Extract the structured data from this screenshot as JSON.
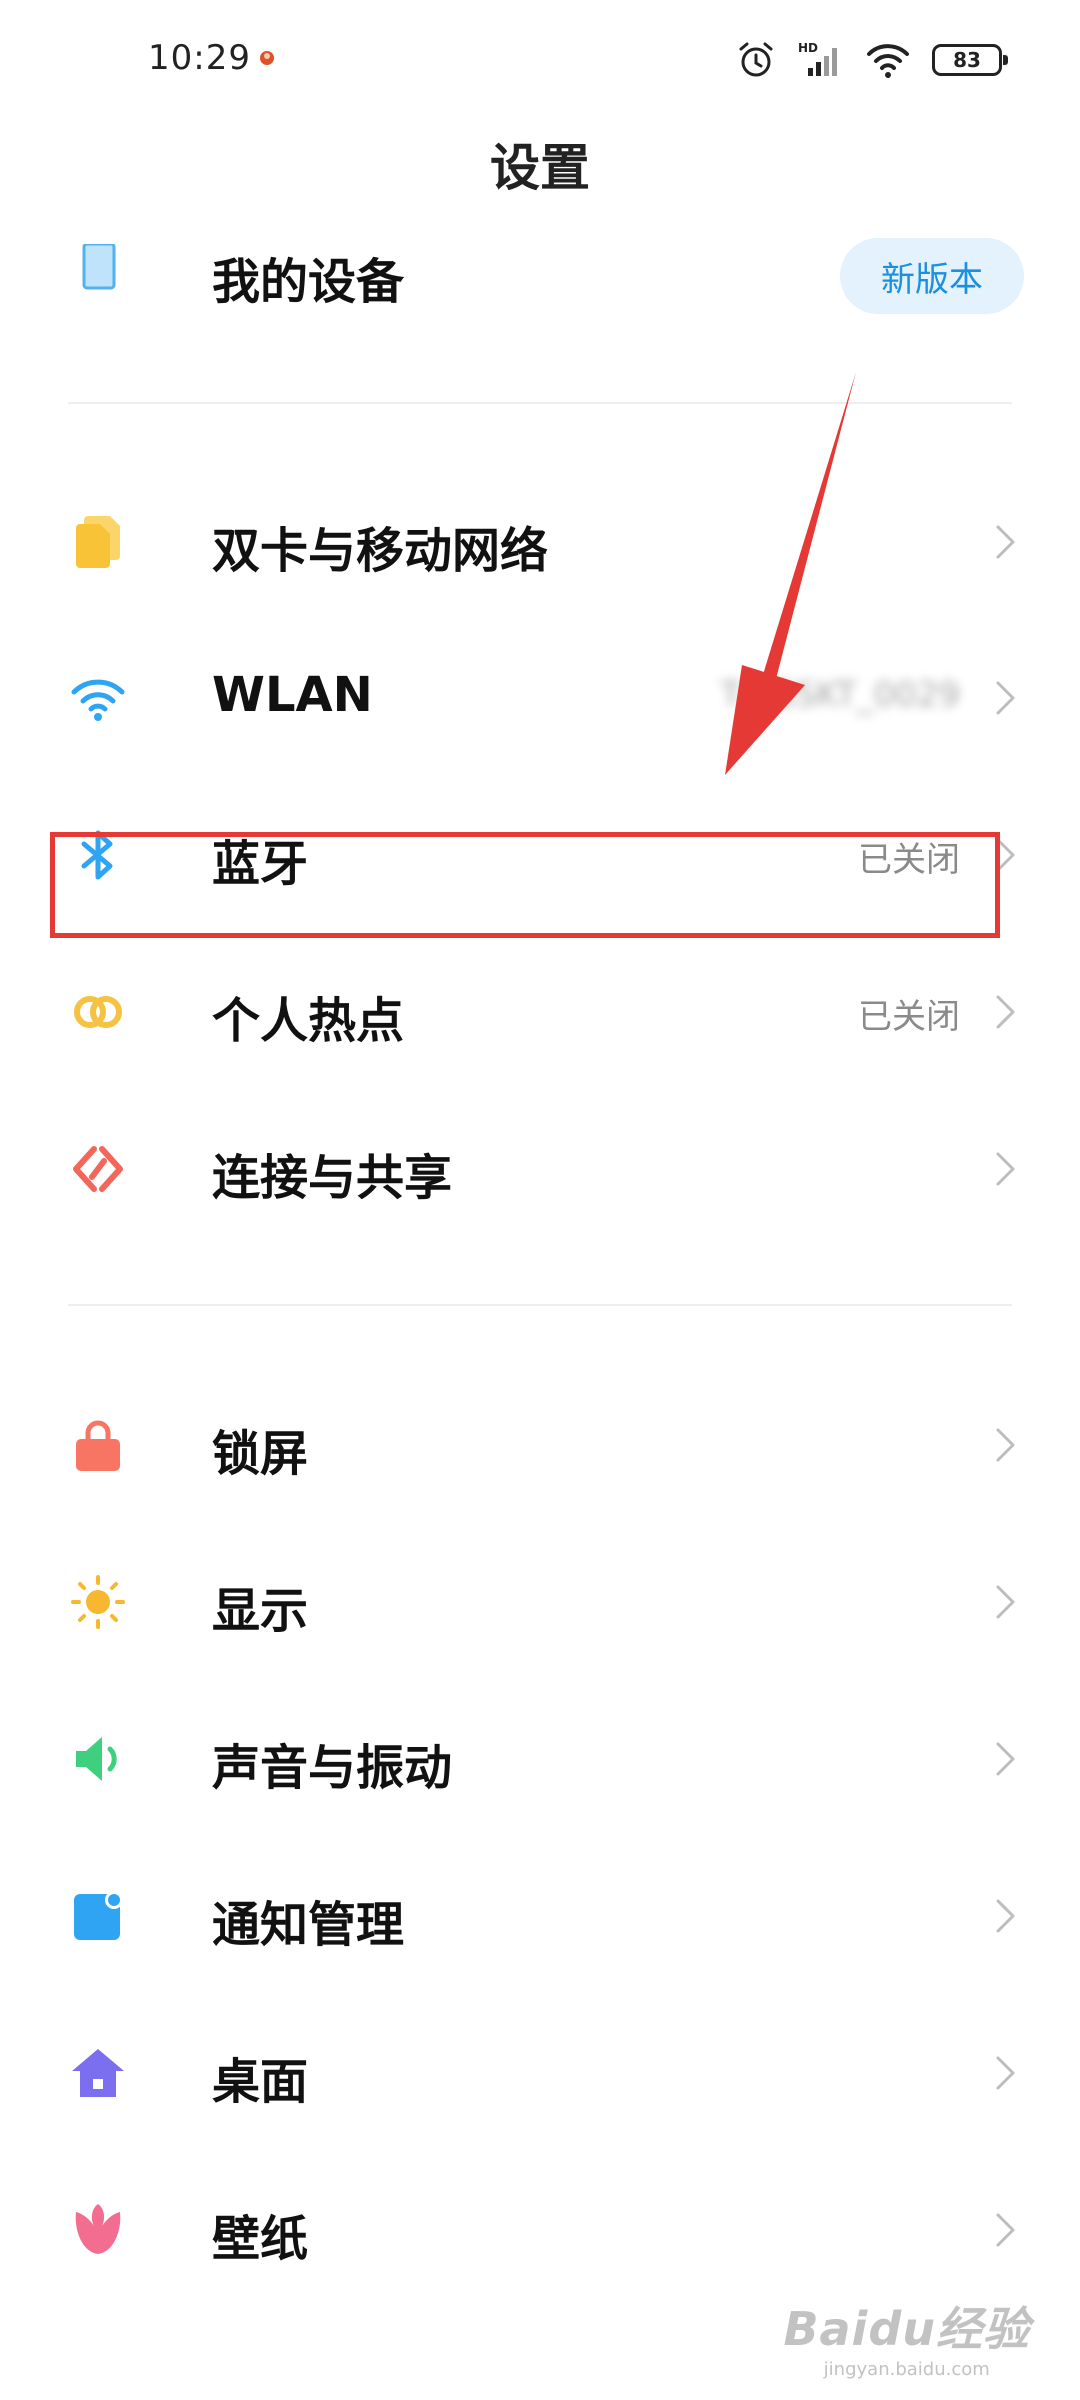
{
  "status_bar": {
    "time": "10:29",
    "battery": "83",
    "icons": [
      "notification-icon",
      "alarm-icon",
      "hd-signal-icon",
      "wifi-icon",
      "battery-icon"
    ]
  },
  "header": {
    "title": "设置"
  },
  "device": {
    "label": "我的设备",
    "badge": "新版本",
    "icon": "phone-icon"
  },
  "network_group": [
    {
      "id": "sim",
      "label": "双卡与移动网络",
      "value": "",
      "icon": "sim-card-icon"
    },
    {
      "id": "wlan",
      "label": "WLAN",
      "value": "T-ASSKT_0029",
      "icon": "wifi-icon"
    },
    {
      "id": "bluetooth",
      "label": "蓝牙",
      "value": "已关闭",
      "icon": "bluetooth-icon"
    },
    {
      "id": "hotspot",
      "label": "个人热点",
      "value": "已关闭",
      "icon": "hotspot-icon"
    },
    {
      "id": "connect",
      "label": "连接与共享",
      "value": "",
      "icon": "share-icon"
    }
  ],
  "system_group": [
    {
      "id": "lock",
      "label": "锁屏",
      "icon": "lock-icon"
    },
    {
      "id": "display",
      "label": "显示",
      "icon": "sun-icon"
    },
    {
      "id": "sound",
      "label": "声音与振动",
      "icon": "speaker-icon"
    },
    {
      "id": "notify",
      "label": "通知管理",
      "icon": "notification-icon"
    },
    {
      "id": "desktop",
      "label": "桌面",
      "icon": "home-icon"
    },
    {
      "id": "wallpaper",
      "label": "壁纸",
      "icon": "tulip-icon"
    }
  ],
  "watermark": {
    "brand": "Baidu经验",
    "site": "jingyan.baidu.com"
  },
  "colors": {
    "accent_blue": "#2196f3",
    "badge_text": "#1b8fe0",
    "badge_bg": "#e3f2fc",
    "annotation_red": "#e53935",
    "sim_yellow": "#f9c338",
    "hotspot_yellow": "#f5c242",
    "share_red": "#f2675a",
    "lock_red": "#f87563",
    "sound_green": "#3ed07f",
    "desktop_purple": "#7b6ff0",
    "wallpaper_pink": "#f26d8f"
  }
}
